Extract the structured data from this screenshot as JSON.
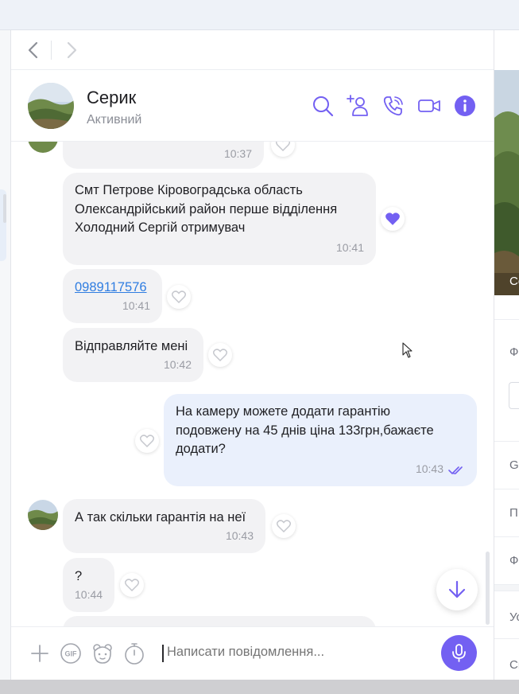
{
  "header": {
    "contact_name": "Серик",
    "contact_status": "Активний"
  },
  "icons": {
    "back": "chevron-left-icon",
    "forward": "chevron-right-icon",
    "search": "search-icon",
    "add_participant": "add-user-icon",
    "call": "phone-icon",
    "video": "video-camera-icon",
    "info": "info-icon",
    "attach": "plus-icon",
    "gif": "gif-icon",
    "sticker": "sticker-icon",
    "timer": "timer-icon",
    "mic": "microphone-icon",
    "scroll_down": "arrow-down-icon",
    "read_status": "double-check-icon",
    "reaction": "heart-icon"
  },
  "messages": [
    {
      "direction": "in",
      "text": "",
      "time": "10:37",
      "liked": false
    },
    {
      "direction": "in",
      "text": "Смт Петрове Кіровоградська область Олександрійський район перше відділення Холодний Сергій отримувач",
      "lines": [
        "Смт Петрове Кіровоградська область",
        "Олександрійський район перше відділення",
        "Холодний Сергій отримувач"
      ],
      "time": "10:41",
      "liked": true
    },
    {
      "direction": "in",
      "text": "0989117576",
      "time": "10:41",
      "liked": false,
      "is_link": true
    },
    {
      "direction": "in",
      "text": "Відправляйте мені",
      "time": "10:42",
      "liked": false
    },
    {
      "direction": "out",
      "text": "На камеру можете додати гарантію подовжену на 45 днів ціна 133грн,бажаєте додати?",
      "lines": [
        "На камеру можете додати гарантію",
        "подовжену на 45 днів ціна 133грн,бажаєте",
        "додати?"
      ],
      "time": "10:43",
      "liked": false,
      "read": true
    },
    {
      "direction": "in",
      "text": "А так скільки гарантія на неї",
      "time": "10:43",
      "liked": false
    },
    {
      "direction": "in",
      "text": "?",
      "time": "10:44",
      "liked": false
    }
  ],
  "composer": {
    "placeholder": "Написати повідомлення..."
  },
  "right_panel": {
    "photo_caption": "Ce",
    "rows": [
      "Ф",
      "G",
      "П",
      "Ф",
      "Ус",
      "Сп"
    ]
  },
  "colors": {
    "accent": "#7360f2",
    "incoming_bubble": "#f2f2f4",
    "outgoing_bubble": "#eaf0fc",
    "link": "#2f7de1"
  }
}
